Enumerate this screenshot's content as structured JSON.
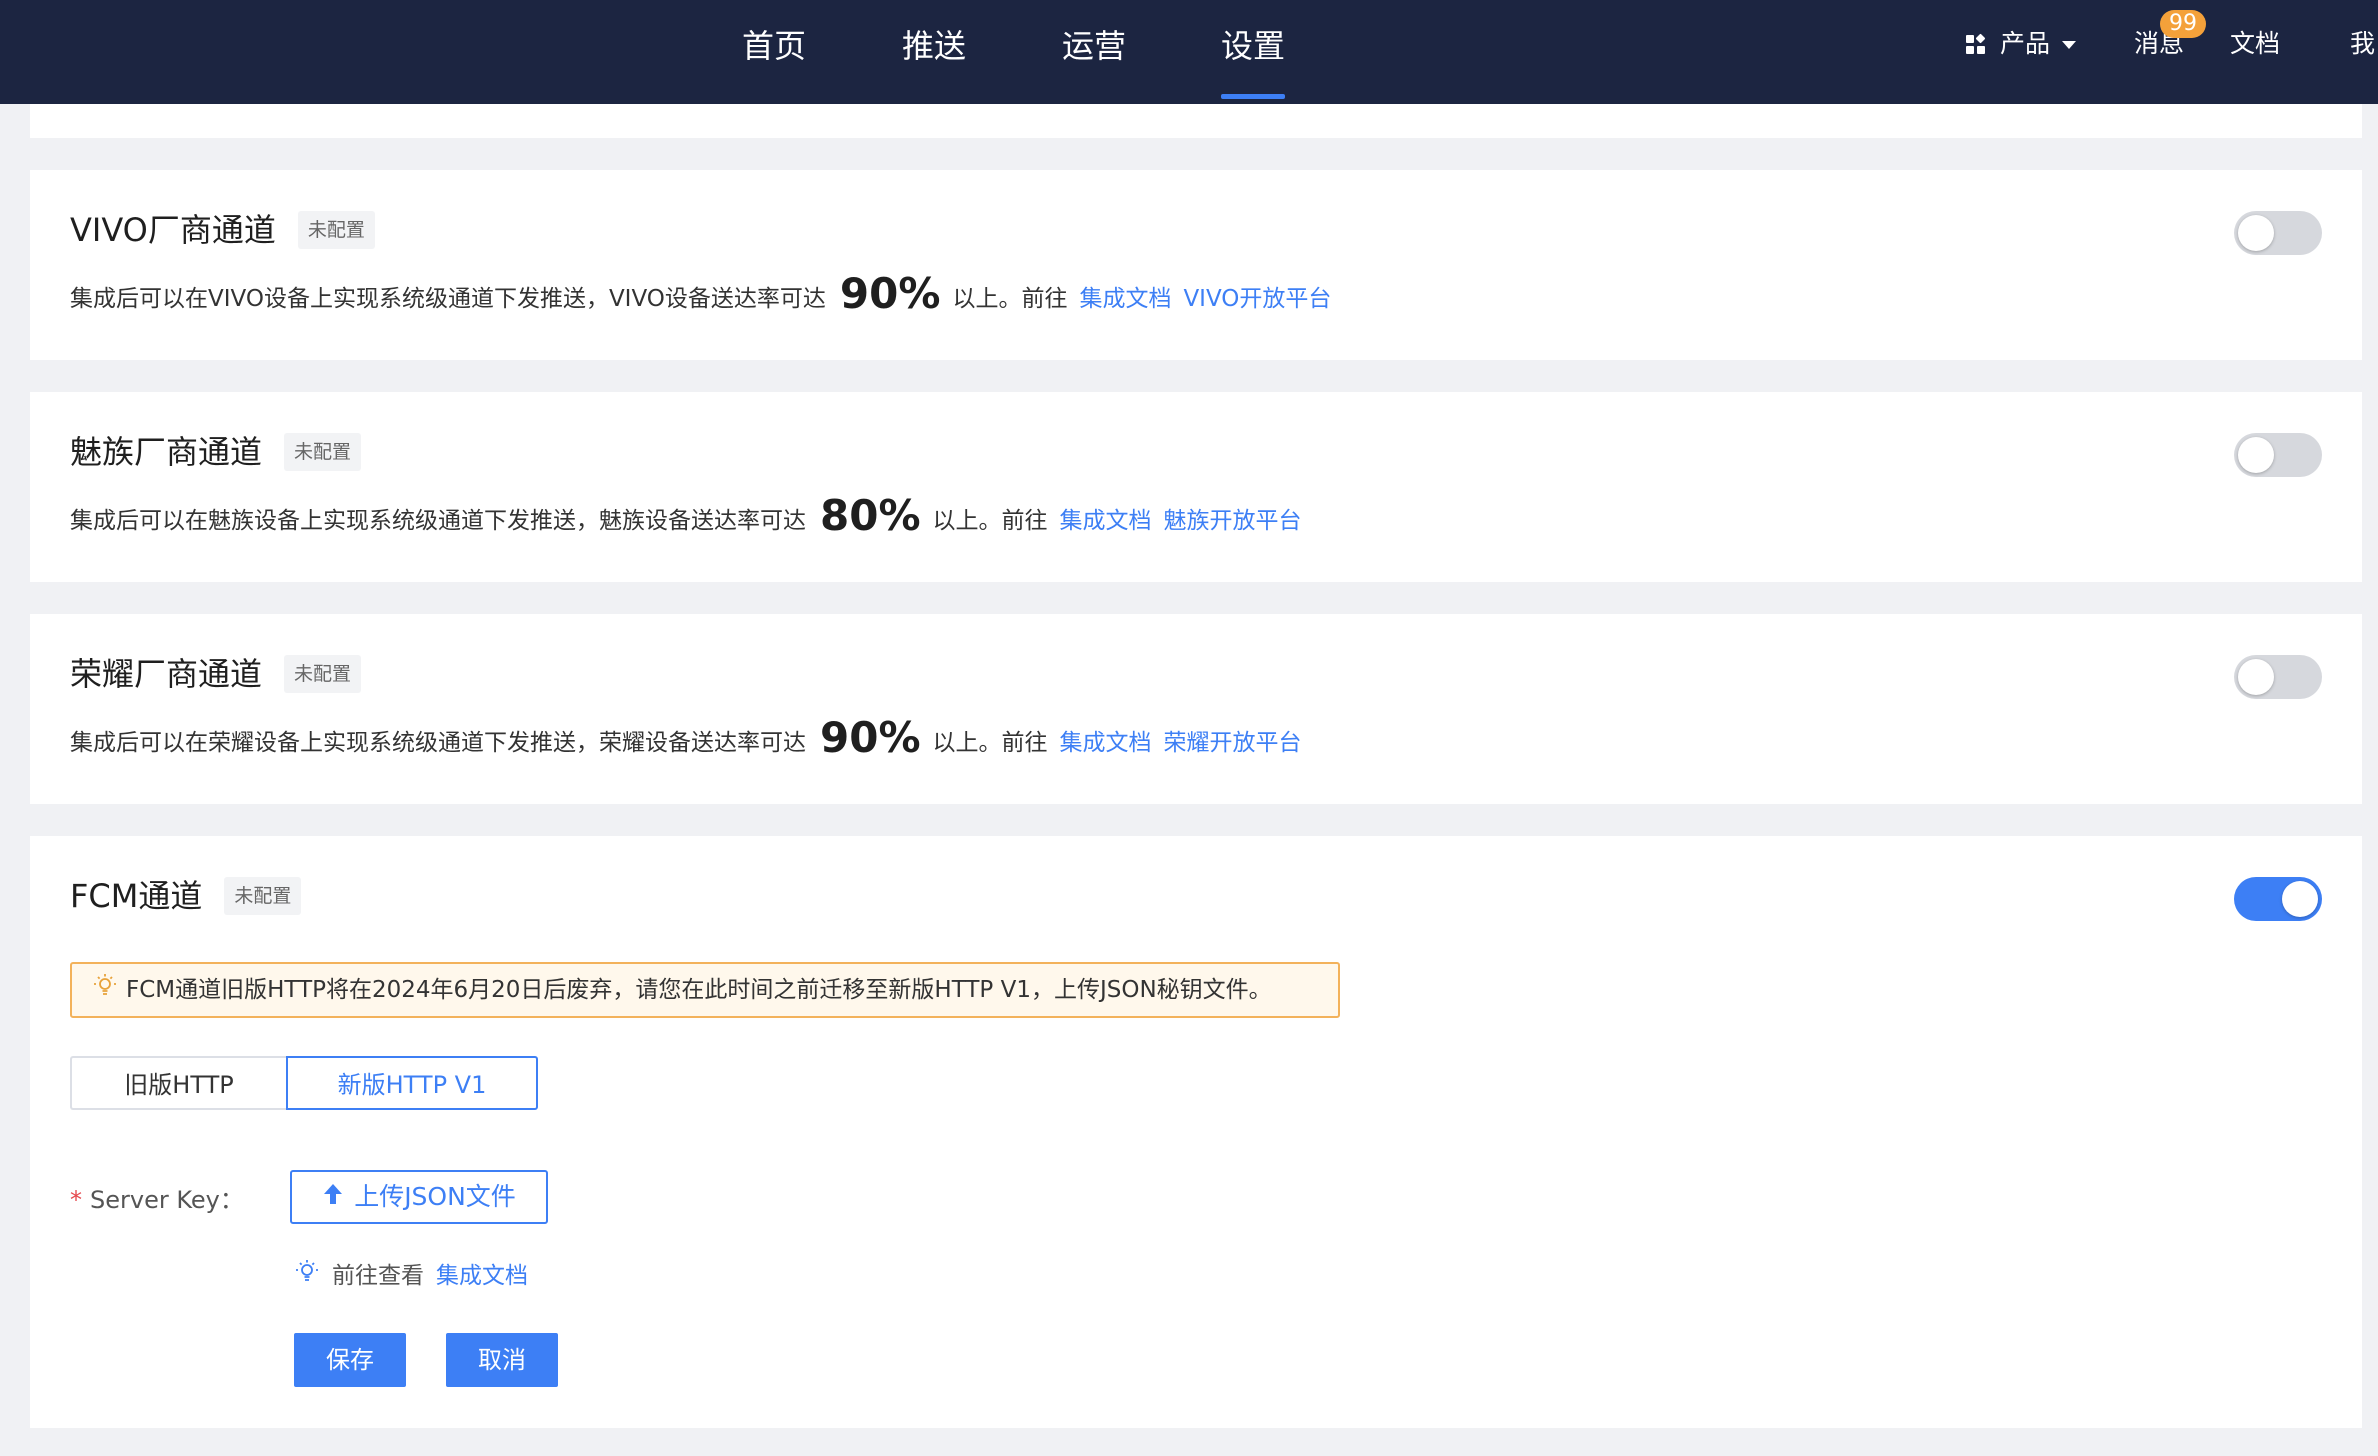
{
  "topnav": {
    "tabs": [
      {
        "label": "首页"
      },
      {
        "label": "推送"
      },
      {
        "label": "运营"
      },
      {
        "label": "设置"
      }
    ],
    "active_tab": "设置",
    "product_label": "产品",
    "messages_label": "消息",
    "messages_badge": "99",
    "docs_label": "文档",
    "me_label": "我"
  },
  "channels": [
    {
      "title": "VIVO厂商通道",
      "status": "未配置",
      "desc_prefix": "集成后可以在VIVO设备上实现系统级通道下发推送，VIVO设备送达率可达",
      "rate": "90%",
      "desc_suffix": "以上。前往",
      "link_docs": "集成文档",
      "link_platform": "VIVO开放平台",
      "enabled": false
    },
    {
      "title": "魅族厂商通道",
      "status": "未配置",
      "desc_prefix": "集成后可以在魅族设备上实现系统级通道下发推送，魅族设备送达率可达",
      "rate": "80%",
      "desc_suffix": "以上。前往",
      "link_docs": "集成文档",
      "link_platform": "魅族开放平台",
      "enabled": false
    },
    {
      "title": "荣耀厂商通道",
      "status": "未配置",
      "desc_prefix": "集成后可以在荣耀设备上实现系统级通道下发推送，荣耀设备送达率可达",
      "rate": "90%",
      "desc_suffix": "以上。前往",
      "link_docs": "集成文档",
      "link_platform": "荣耀开放平台",
      "enabled": false
    }
  ],
  "fcm": {
    "title": "FCM通道",
    "status": "未配置",
    "enabled": true,
    "warning": "FCM通道旧版HTTP将在2024年6月20日后废弃，请您在此时间之前迁移至新版HTTP V1，上传JSON秘钥文件。",
    "tabs": {
      "old": "旧版HTTP",
      "new": "新版HTTP V1",
      "active": "新版HTTP V1"
    },
    "server_key_label": "Server Key：",
    "required_mark": "*",
    "upload_label": "上传JSON文件",
    "hint_prefix": "前往查看",
    "hint_link": "集成文档",
    "save_label": "保存",
    "cancel_label": "取消"
  },
  "colors": {
    "topbar": "#1c2541",
    "accent": "#3d7ff5",
    "badge": "#f4a13a",
    "warning_border": "#f3b25b",
    "warning_bg": "#fff8ec",
    "page_bg": "#f0f1f4"
  }
}
